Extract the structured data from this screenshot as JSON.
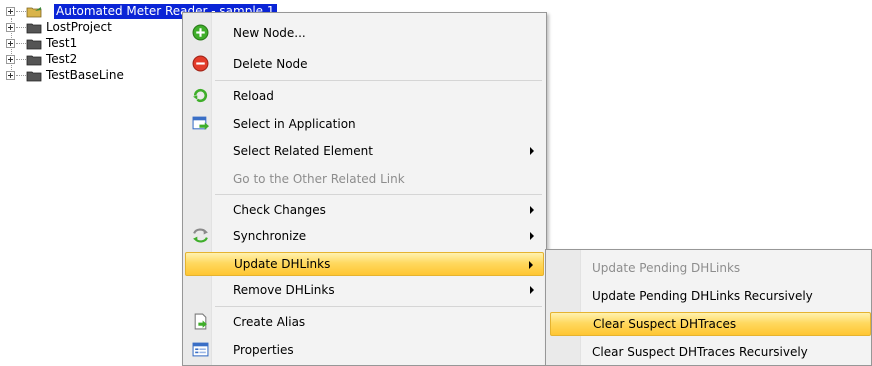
{
  "tree": {
    "items": [
      {
        "label": "Automated Meter Reader - sample 1",
        "selected": true
      },
      {
        "label": "LostProject"
      },
      {
        "label": "Test1"
      },
      {
        "label": "Test2"
      },
      {
        "label": "TestBaseLine"
      }
    ]
  },
  "context_menu": {
    "new_node": "New Node...",
    "delete_node": "Delete Node",
    "reload": "Reload",
    "select_in_application": "Select in Application",
    "select_related_element": "Select Related Element",
    "go_to_other_related_link": "Go to the Other Related Link",
    "check_changes": "Check Changes",
    "synchronize": "Synchronize",
    "update_dhlinks": "Update DHLinks",
    "remove_dhlinks": "Remove DHLinks",
    "create_alias": "Create Alias",
    "properties": "Properties"
  },
  "submenu": {
    "update_pending_dhlinks": "Update Pending DHLinks",
    "update_pending_dhlinks_recursively": "Update Pending DHLinks Recursively",
    "clear_suspect_dhtraces": "Clear Suspect DHTraces",
    "clear_suspect_dhtraces_recursively": "Clear Suspect DHTraces Recursively"
  },
  "colors": {
    "selection": "#0a24d6",
    "menu_highlight": "#ffd960",
    "menu_background": "#f3f3f3",
    "disabled_text": "#8d8d8d"
  }
}
